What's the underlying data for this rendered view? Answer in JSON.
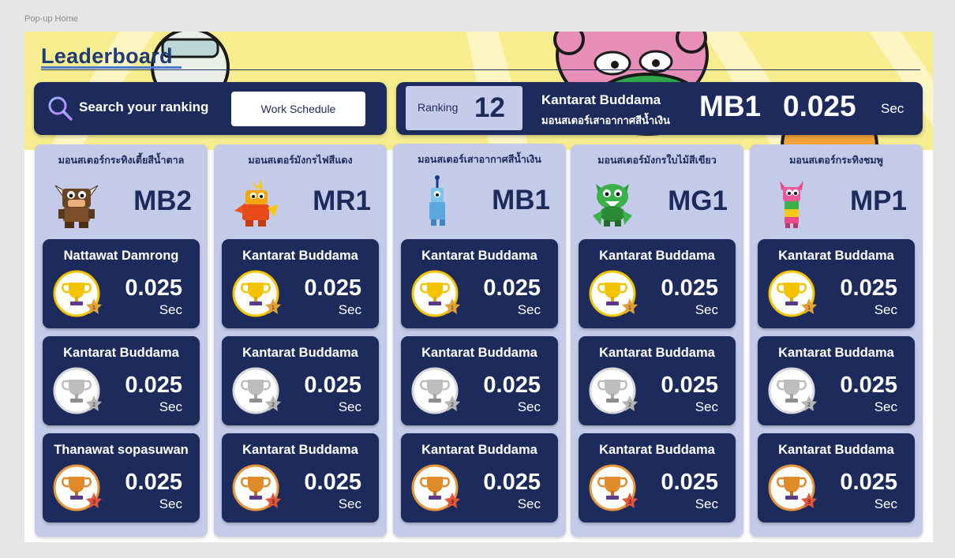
{
  "frame_label": "Pop-up Home",
  "title": "Leaderboard",
  "search": {
    "label": "Search your ranking",
    "work_schedule": "Work Schedule"
  },
  "my_rank": {
    "label": "Ranking",
    "rank": "12",
    "name": "Kantarat Buddama",
    "monster": "มอนสเตอร์เสาอากาศสีน้ำเงิน",
    "code": "MB1",
    "time": "0.025",
    "unit": "Sec"
  },
  "colors": {
    "navy": "#1d2b5c",
    "panel": "#c3cbe9",
    "banner": "#f7ec8e",
    "gold": "#f5c400",
    "silver": "#b8b8b8",
    "bronze": "#e08a2a"
  },
  "columns": [
    {
      "name": "มอนสเตอร์กระทิงเตี้ยสีน้ำตาล",
      "code": "MB2",
      "mascot": "brown-bull-monster-icon",
      "entries": [
        {
          "rank": 1,
          "medal": "gold-trophy-icon",
          "name": "Nattawat Damrong",
          "time": "0.025",
          "unit": "Sec"
        },
        {
          "rank": 2,
          "medal": "silver-trophy-icon",
          "name": "Kantarat Buddama",
          "time": "0.025",
          "unit": "Sec"
        },
        {
          "rank": 3,
          "medal": "bronze-trophy-icon",
          "name": "Thanawat sopasuwan",
          "time": "0.025",
          "unit": "Sec"
        }
      ]
    },
    {
      "name": "มอนสเตอร์มังกรไฟสีแดง",
      "code": "MR1",
      "mascot": "red-fire-dragon-icon",
      "entries": [
        {
          "rank": 1,
          "medal": "gold-trophy-icon",
          "name": "Kantarat Buddama",
          "time": "0.025",
          "unit": "Sec"
        },
        {
          "rank": 2,
          "medal": "silver-trophy-icon",
          "name": "Kantarat Buddama",
          "time": "0.025",
          "unit": "Sec"
        },
        {
          "rank": 3,
          "medal": "bronze-trophy-icon",
          "name": "Kantarat Buddama",
          "time": "0.025",
          "unit": "Sec"
        }
      ]
    },
    {
      "name": "มอนสเตอร์เสาอากาศสีน้ำเงิน",
      "code": "MB1",
      "mascot": "blue-antenna-monster-icon",
      "entries": [
        {
          "rank": 1,
          "medal": "gold-trophy-icon",
          "name": "Kantarat Buddama",
          "time": "0.025",
          "unit": "Sec"
        },
        {
          "rank": 2,
          "medal": "silver-trophy-icon",
          "name": "Kantarat Buddama",
          "time": "0.025",
          "unit": "Sec"
        },
        {
          "rank": 3,
          "medal": "bronze-trophy-icon",
          "name": "Kantarat Buddama",
          "time": "0.025",
          "unit": "Sec"
        }
      ]
    },
    {
      "name": "มอนสเตอร์มังกรใบไม้สีเขียว",
      "code": "MG1",
      "mascot": "green-leaf-dragon-icon",
      "entries": [
        {
          "rank": 1,
          "medal": "gold-trophy-icon",
          "name": "Kantarat Buddama",
          "time": "0.025",
          "unit": "Sec"
        },
        {
          "rank": 2,
          "medal": "silver-trophy-icon",
          "name": "Kantarat Buddama",
          "time": "0.025",
          "unit": "Sec"
        },
        {
          "rank": 3,
          "medal": "bronze-trophy-icon",
          "name": "Kantarat Buddama",
          "time": "0.025",
          "unit": "Sec"
        }
      ]
    },
    {
      "name": "มอนสเตอร์กระทิงชมพู",
      "code": "MP1",
      "mascot": "pink-bull-monster-icon",
      "entries": [
        {
          "rank": 1,
          "medal": "gold-trophy-icon",
          "name": "Kantarat Buddama",
          "time": "0.025",
          "unit": "Sec"
        },
        {
          "rank": 2,
          "medal": "silver-trophy-icon",
          "name": "Kantarat Buddama",
          "time": "0.025",
          "unit": "Sec"
        },
        {
          "rank": 3,
          "medal": "bronze-trophy-icon",
          "name": "Kantarat Buddama",
          "time": "0.025",
          "unit": "Sec"
        }
      ]
    }
  ]
}
